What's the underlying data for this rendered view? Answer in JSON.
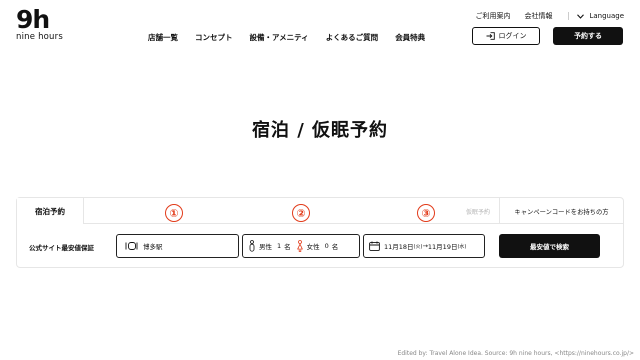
{
  "logo": {
    "mark": "9h",
    "text": "nine hours"
  },
  "utility_nav": {
    "guide": "ご利用案内",
    "company": "会社情報",
    "language": "Language"
  },
  "main_nav": [
    "店舗一覧",
    "コンセプト",
    "設備・アメニティ",
    "よくあるご質問",
    "会員特典"
  ],
  "header_buttons": {
    "login": "ログイン",
    "reserve": "予約する"
  },
  "page_title": "宿泊 / 仮眠予約",
  "booking": {
    "tabs": {
      "stay": "宿泊予約",
      "nap": "仮眠予約",
      "campaign": "キャンペーンコードをお持ちの方"
    },
    "markers": [
      "①",
      "②",
      "③"
    ],
    "guarantee": "公式サイト最安値保証",
    "location": "博多駅",
    "guests": {
      "male_label": "男性",
      "male_count": "1",
      "male_unit": "名",
      "female_label": "女性",
      "female_count": "0",
      "female_unit": "名"
    },
    "dates": {
      "checkin": "11月18日",
      "checkin_dow": "(火)",
      "arrow": "→",
      "checkout": "11月19日",
      "checkout_dow": "(水)"
    },
    "search_button": "最安値で検索"
  },
  "credit": "Edited by: Travel Alone Idea. Source: 9h nine hours, <https://ninehours.co.jp/>",
  "colors": {
    "accent_red": "#e23b1a",
    "primary": "#111111",
    "border": "#e6e6e6"
  }
}
